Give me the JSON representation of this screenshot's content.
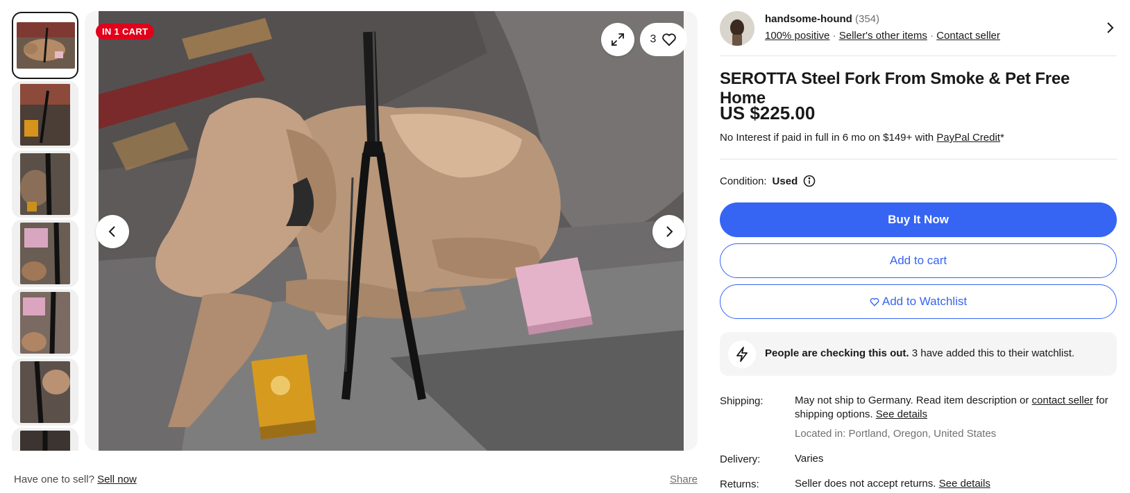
{
  "gallery": {
    "badge": "IN 1 CART",
    "watch_count": "3",
    "thumbnails": [
      "photo-1",
      "photo-2",
      "photo-3",
      "photo-4",
      "photo-5",
      "photo-6",
      "photo-7"
    ],
    "icons": {
      "expand": "expand-icon",
      "heart": "heart-icon",
      "prev": "chevron-left-icon",
      "next": "chevron-right-icon"
    }
  },
  "below_gallery": {
    "sell_prompt": "Have one to sell?",
    "sell_link": "Sell now",
    "share": "Share"
  },
  "seller": {
    "name": "handsome-hound",
    "feedback_count": "(354)",
    "positive": "100% positive",
    "other_items": "Seller's other items",
    "contact": "Contact seller"
  },
  "listing": {
    "title": "SEROTTA Steel Fork From Smoke & Pet Free Home",
    "price": "US $225.00",
    "financing_text": "No Interest if paid in full in 6 mo on $149+ with",
    "financing_link": "PayPal Credit",
    "financing_suffix": "*",
    "condition_label": "Condition:",
    "condition_value": "Used"
  },
  "actions": {
    "buy_now": "Buy It Now",
    "add_to_cart": "Add to cart",
    "add_to_watchlist": "Add to Watchlist"
  },
  "notice": {
    "bold": "People are checking this out.",
    "text": "3 have added this to their watchlist."
  },
  "details": {
    "shipping_label": "Shipping:",
    "shipping_text1": "May not ship to Germany. Read item description or",
    "shipping_link": "contact seller",
    "shipping_text2": "for shipping options.",
    "shipping_details": "See details",
    "location": "Located in: Portland, Oregon, United States",
    "delivery_label": "Delivery:",
    "delivery_value": "Varies",
    "returns_label": "Returns:",
    "returns_value": "Seller does not accept returns.",
    "returns_link": "See details"
  },
  "colors": {
    "primary": "#3665f3",
    "badge_red": "#e0021b",
    "text": "#191919",
    "muted": "#707070"
  }
}
